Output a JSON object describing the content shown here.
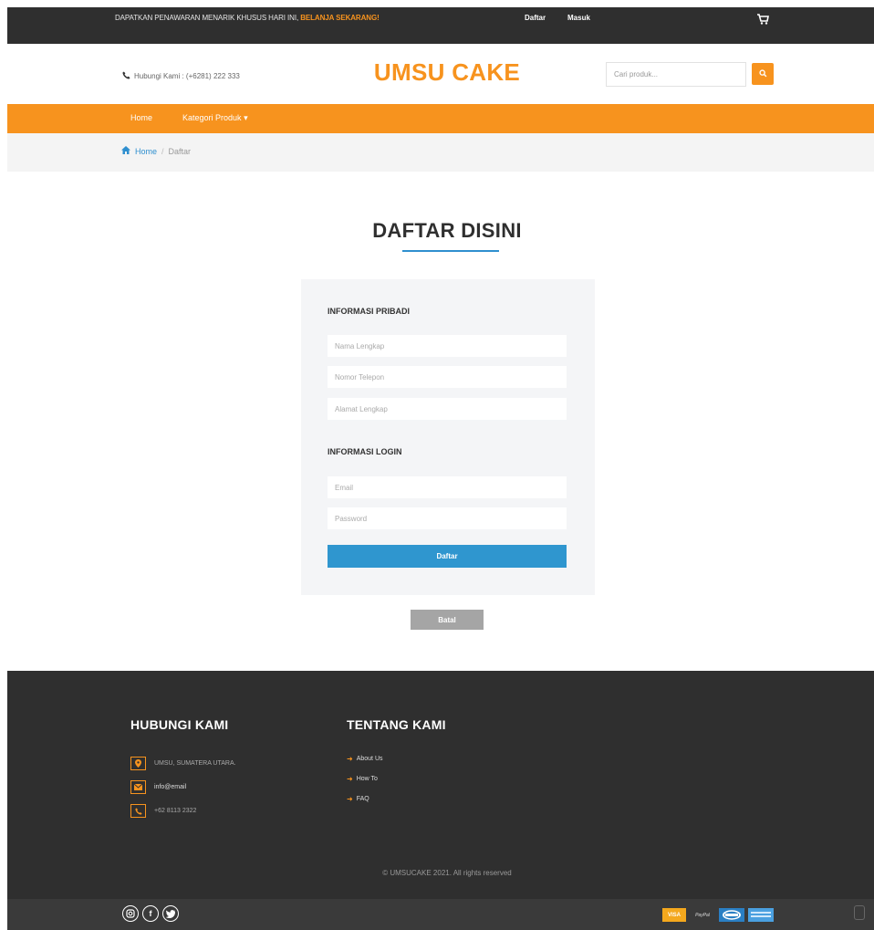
{
  "topbar": {
    "promo_text": "DAPATKAN PENAWARAN MENARIK KHUSUS HARI INI,",
    "promo_link": "BELANJA SEKARANG!",
    "register_link": "Daftar",
    "login_link": "Masuk",
    "cart_icon": "cart-icon"
  },
  "header": {
    "phone_label": "Hubungi Kami : (+6281) 222 333",
    "brand": "UMSU CAKE",
    "search_placeholder": "Cari produk...",
    "search_icon": "search-icon"
  },
  "nav": {
    "home": "Home",
    "categories": "Kategori Produk"
  },
  "breadcrumb": {
    "home": "Home",
    "separator": "/",
    "current": "Daftar"
  },
  "page": {
    "title": "DAFTAR DISINI"
  },
  "form": {
    "personal_title": "INFORMASI PRIBADI",
    "name_placeholder": "Nama Lengkap",
    "phone_placeholder": "Nomor Telepon",
    "address_placeholder": "Alamat Lengkap",
    "login_title": "INFORMASI LOGIN",
    "email_placeholder": "Email",
    "password_placeholder": "Password",
    "submit": "Daftar",
    "cancel": "Batal"
  },
  "footer": {
    "contact_title": "HUBUNGI KAMI",
    "address": "UMSU, SUMATERA UTARA.",
    "email": "info@email",
    "phone": "+62 8113 2322",
    "about_title": "TENTANG KAMI",
    "about_links": [
      "About Us",
      "How To",
      "FAQ"
    ],
    "copyright": "© UMSUCAKE 2021. All rights reserved"
  },
  "bottombar": {
    "social": [
      "instagram-icon",
      "facebook-icon",
      "twitter-icon"
    ],
    "payments": [
      "VISA",
      "PayPal",
      "MasterCard",
      "American Express"
    ]
  },
  "colors": {
    "accent": "#f7931e",
    "primary_button": "#2f96cf",
    "dark": "#2f2f2f"
  }
}
